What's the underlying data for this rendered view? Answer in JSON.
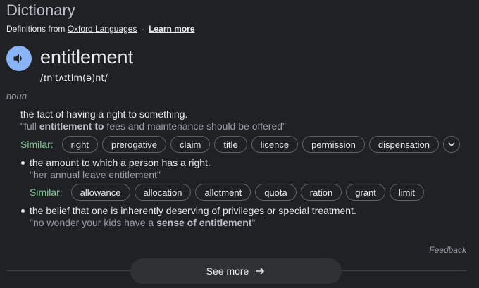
{
  "header": {
    "title": "Dictionary",
    "source_prefix": "Definitions from",
    "source_name": "Oxford Languages",
    "separator": "·",
    "learn_more": "Learn more"
  },
  "entry": {
    "word": "entitlement",
    "phonetic": "/ɪnˈtʌɪtlm(ə)nt/",
    "part_of_speech": "noun",
    "audio_icon": "speaker-icon"
  },
  "senses": [
    {
      "definition": "the fact of having a right to something.",
      "example_pre": "\"full ",
      "example_bold": "entitlement to",
      "example_post": " fees and maintenance should be offered\"",
      "similar_label": "Similar:",
      "similar": [
        "right",
        "prerogative",
        "claim",
        "title",
        "licence",
        "permission",
        "dispensation"
      ]
    },
    {
      "definition": "the amount to which a person has a right.",
      "example": "\"her annual leave entitlement\"",
      "similar_label": "Similar:",
      "similar": [
        "allowance",
        "allocation",
        "allotment",
        "quota",
        "ration",
        "grant",
        "limit"
      ]
    },
    {
      "definition_parts": [
        "the belief that one is ",
        "inherently",
        " ",
        "deserving",
        " of ",
        "privileges",
        " or special treatment."
      ],
      "example_pre": "\"no wonder your kids have a ",
      "example_bold": "sense of entitlement",
      "example_post": "\""
    }
  ],
  "footer": {
    "feedback": "Feedback",
    "see_more": "See more"
  },
  "colors": {
    "background": "#202124",
    "accent_blue": "#8ab4f8",
    "similar_green": "#81c995"
  }
}
